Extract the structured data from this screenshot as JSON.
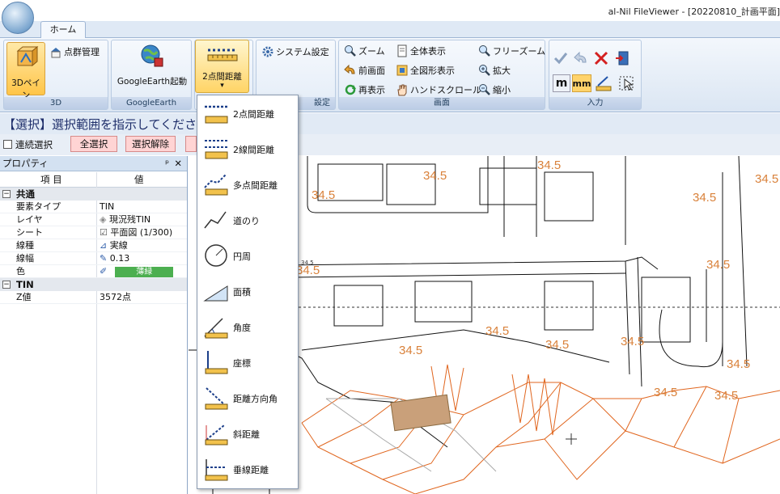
{
  "window": {
    "title": "al-Nil FileViewer - [20220810_計画平面]"
  },
  "tabs": [
    {
      "label": "ホーム"
    }
  ],
  "ribbon": {
    "groups": {
      "g3d": {
        "label": "3D",
        "big_button": "3Dペイン",
        "small_button": "点群管理"
      },
      "ge": {
        "label": "GoogleEarth",
        "big_button": "GoogleEarth起動"
      },
      "measure": {
        "big_button": "2点間距離",
        "label": "設定"
      },
      "settings": {
        "small_button": "システム設定"
      },
      "screen": {
        "label": "画面",
        "items": [
          "ズーム",
          "全体表示",
          "フリーズーム",
          "前画面",
          "全図形表示",
          "拡大",
          "再表示",
          "ハンドスクロール",
          "縮小"
        ]
      },
      "input": {
        "label": "入力",
        "unit_m": "m",
        "unit_mm": "mm"
      }
    }
  },
  "prompt": {
    "text": "【選択】選択範囲を指示してください"
  },
  "selection": {
    "checkbox_label": "連続選択",
    "select_all": "全選択",
    "deselect": "選択解除"
  },
  "properties": {
    "title": "プロパティ",
    "col_item": "項 目",
    "col_value": "値",
    "categories": [
      {
        "name": "共通",
        "rows": [
          {
            "key": "要素タイプ",
            "value": "TIN"
          },
          {
            "key": "レイヤ",
            "value": "現況残TIN"
          },
          {
            "key": "シート",
            "value": "平面図 (1/300)"
          },
          {
            "key": "線種",
            "value": "実線"
          },
          {
            "key": "線幅",
            "value": "0.13"
          },
          {
            "key": "色",
            "value": "薄緑"
          }
        ]
      },
      {
        "name": "TIN",
        "rows": [
          {
            "key": "Z値",
            "value": "3572点"
          }
        ]
      }
    ]
  },
  "dropdown": {
    "items": [
      "2点間距離",
      "2線間距離",
      "多点間距離",
      "道のり",
      "円周",
      "面積",
      "角度",
      "座標",
      "距離方向角",
      "斜距離",
      "垂線距離"
    ]
  },
  "map": {
    "contour_labels": [
      "34.5",
      "34.5",
      "34.5",
      "34.5",
      "34.5",
      "34.5",
      "34.5",
      "34.5",
      "34.5",
      "34.5",
      "34.5",
      "34.5",
      "34.5",
      "34.5"
    ],
    "small_label": "34.5"
  },
  "colors": {
    "accent": "#2f5f9a",
    "contour": "#d9813a",
    "tin": "#e0661f",
    "color_swatch": "#4caf50"
  }
}
